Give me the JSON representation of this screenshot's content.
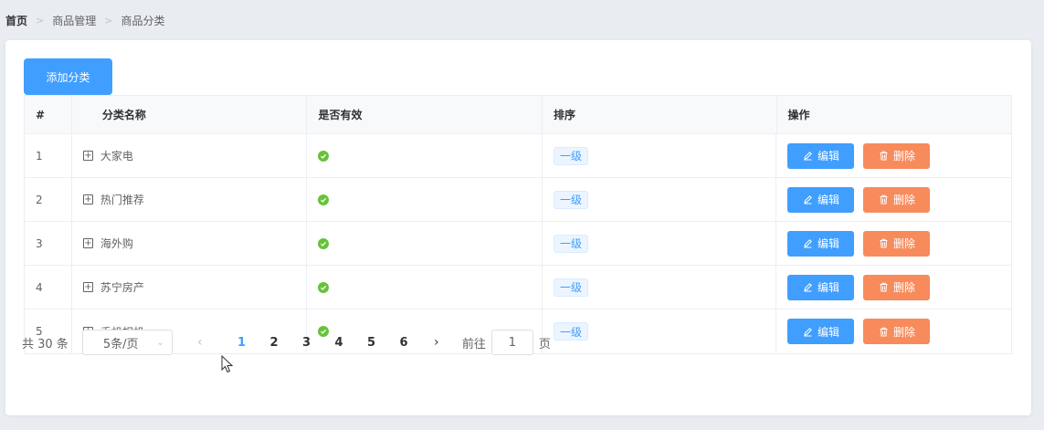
{
  "breadcrumb": [
    "首页",
    "商品管理",
    "商品分类"
  ],
  "toolbar": {
    "add_label": "添加分类"
  },
  "table": {
    "headers": [
      "#",
      "分类名称",
      "是否有效",
      "排序",
      "操作"
    ],
    "rows": [
      {
        "index": "1",
        "name": "大家电",
        "valid": true,
        "level": "一级"
      },
      {
        "index": "2",
        "name": "热门推荐",
        "valid": true,
        "level": "一级"
      },
      {
        "index": "3",
        "name": "海外购",
        "valid": true,
        "level": "一级"
      },
      {
        "index": "4",
        "name": "苏宁房产",
        "valid": true,
        "level": "一级"
      },
      {
        "index": "5",
        "name": "手机相机",
        "valid": true,
        "level": "一级"
      }
    ],
    "edit_label": "编辑",
    "delete_label": "删除"
  },
  "pagination": {
    "total_text": "共 30 条",
    "page_size": "5条/页",
    "pages": [
      "1",
      "2",
      "3",
      "4",
      "5",
      "6"
    ],
    "current_page": "1",
    "goto_label": "前往",
    "goto_value": "1",
    "page_suffix": "页"
  },
  "colors": {
    "primary": "#409eff",
    "danger": "#f78b5c",
    "success": "#67c23a",
    "background": "#e9ecf1"
  }
}
